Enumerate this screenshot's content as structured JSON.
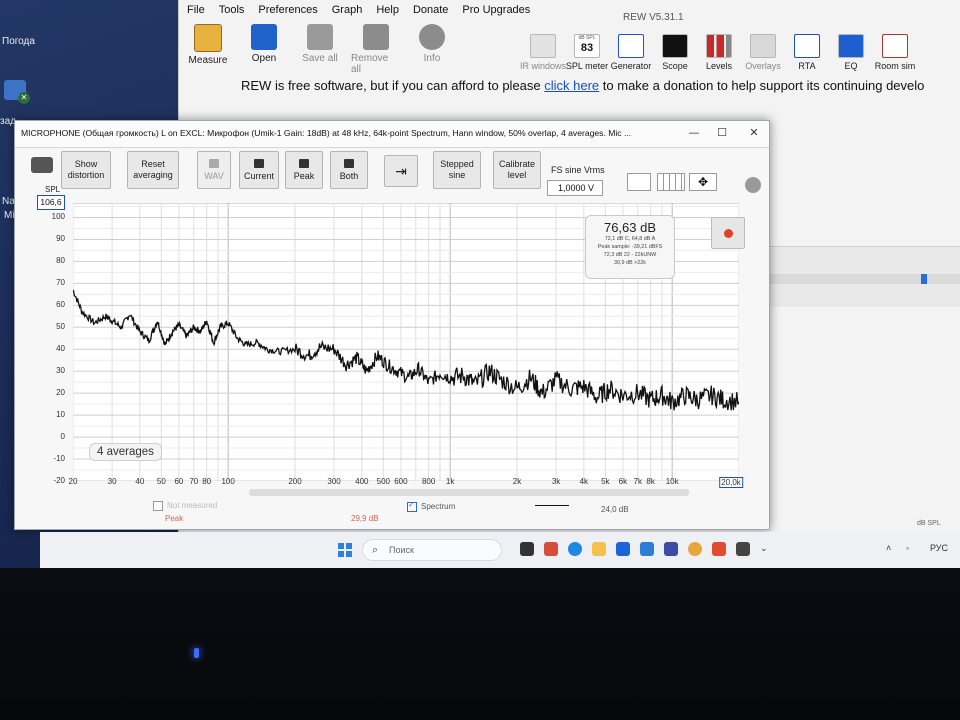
{
  "desktop": {
    "weather_label": "Погода",
    "side_labels": [
      "Nar",
      "Mic"
    ],
    "side_label_top": "зад"
  },
  "rew": {
    "menu": [
      "File",
      "Tools",
      "Preferences",
      "Graph",
      "Help",
      "Donate",
      "Pro Upgrades"
    ],
    "title": "REW V5.31.1",
    "tools_left": [
      {
        "label": "Measure",
        "icon": "measure-icon",
        "color": "#e0a23a"
      },
      {
        "label": "Open",
        "icon": "folder-icon",
        "color": "#1f62c9"
      },
      {
        "label": "Save all",
        "icon": "save-icon",
        "color": "#8a8a8a"
      },
      {
        "label": "Remove all",
        "icon": "remove-icon",
        "color": "#8a8a8a"
      },
      {
        "label": "Info",
        "icon": "info-icon",
        "color": "#8a8a8a"
      }
    ],
    "tools_right": [
      {
        "label": "IR windows",
        "icon": "ir-windows-icon"
      },
      {
        "label": "SPL meter",
        "icon": "spl-meter-icon",
        "value": "83",
        "tag": "dB SPL"
      },
      {
        "label": "Generator",
        "icon": "generator-icon"
      },
      {
        "label": "Scope",
        "icon": "scope-icon"
      },
      {
        "label": "Levels",
        "icon": "levels-icon"
      },
      {
        "label": "Overlays",
        "icon": "overlays-icon"
      },
      {
        "label": "RTA",
        "icon": "rta-icon"
      },
      {
        "label": "EQ",
        "icon": "eq-icon"
      },
      {
        "label": "Room sim",
        "icon": "room-sim-icon"
      }
    ],
    "donate_before": "REW is free software, but if you can afford to please ",
    "donate_link": "click here",
    "donate_after": " to make a donation to help support its continuing develo",
    "db_spl_fragment": "dB SPL"
  },
  "spectrum": {
    "window_title": "MICROPHONE (Общая громкость) L on EXCL: Микрофон (Umik-1  Gain: 18dB) at 48 kHz, 64k-point Spectrum, Hann window, 50% overlap, 4 averages. Mic ...",
    "buttons": {
      "show_distortion": [
        "Show",
        "distortion"
      ],
      "reset_averaging": [
        "Reset",
        "averaging"
      ],
      "wav": "WAV",
      "current": "Current",
      "peak": "Peak",
      "both": "Both",
      "stepped_sine": [
        "Stepped",
        "sine"
      ],
      "calibrate_level": [
        "Calibrate",
        "level"
      ]
    },
    "fs_sine_label": "FS sine Vrms",
    "fs_sine_value": "1,0000 V",
    "spl_label": "SPL",
    "spl_top_value": "106,6",
    "readout_main": "76,63 dB",
    "readout_lines": [
      "72,1 dB C, 64,8 dB A",
      "Peak sample: -39,21 dBFS",
      "72,3 dB 22 - 22kUNW",
      "30,9 dB >22k"
    ],
    "averages_badge": "4 averages",
    "legend": {
      "item1_label": "Not measured",
      "item2_label": "Peak",
      "item2_value": "29,9 dB",
      "spectrum_label": "Spectrum",
      "spectrum_value": "24,0 dB"
    }
  },
  "chart_data": {
    "type": "line",
    "x_scale": "log",
    "xlim": [
      20,
      20000
    ],
    "ylim": [
      -20,
      106.6
    ],
    "y_ticks": [
      "100",
      "90",
      "80",
      "70",
      "60",
      "50",
      "40",
      "30",
      "20",
      "10",
      "0",
      "-10",
      "-20"
    ],
    "x_ticks": [
      "20",
      "30",
      "40",
      "50",
      "60",
      "70",
      "80",
      "100",
      "200",
      "300",
      "400",
      "500",
      "600",
      "800",
      "1k",
      "2k",
      "3k",
      "4k",
      "5k",
      "6k",
      "7k",
      "8k",
      "10k",
      "20,0k"
    ],
    "x_tick_values": [
      20,
      30,
      40,
      50,
      60,
      70,
      80,
      100,
      200,
      300,
      400,
      500,
      600,
      800,
      1000,
      2000,
      3000,
      4000,
      5000,
      6000,
      7000,
      8000,
      10000,
      20000
    ],
    "grid": true,
    "series": [
      {
        "color": "#111111",
        "x": [
          20,
          22,
          25,
          28,
          30,
          33,
          36,
          40,
          44,
          48,
          52,
          56,
          60,
          65,
          70,
          75,
          80,
          86,
          92,
          100,
          110,
          120,
          135,
          150,
          170,
          200,
          230,
          260,
          300,
          340,
          380,
          420,
          470,
          520,
          580,
          650,
          720,
          800,
          900,
          1000,
          1150,
          1300,
          1500,
          1700,
          2000,
          2300,
          2600,
          3000,
          3500,
          4000,
          4600,
          5200,
          6000,
          7000,
          8000,
          9000,
          10000,
          11500,
          13000,
          15000,
          17000,
          20000
        ],
        "y": [
          67,
          57,
          52,
          55,
          53,
          50,
          56,
          48,
          44,
          53,
          42,
          48,
          51,
          46,
          50,
          48,
          53,
          43,
          50,
          52,
          45,
          42,
          43,
          40,
          39,
          40,
          37,
          41,
          40,
          33,
          36,
          30,
          37,
          33,
          30,
          27,
          31,
          25,
          29,
          27,
          28,
          24,
          30,
          26,
          22,
          27,
          20,
          26,
          22,
          23,
          18,
          22,
          19,
          20,
          17,
          19,
          16,
          19,
          17,
          19,
          17,
          16
        ]
      }
    ]
  },
  "taskbar": {
    "search_placeholder": "Поиск",
    "tray_lang": "РУС"
  }
}
